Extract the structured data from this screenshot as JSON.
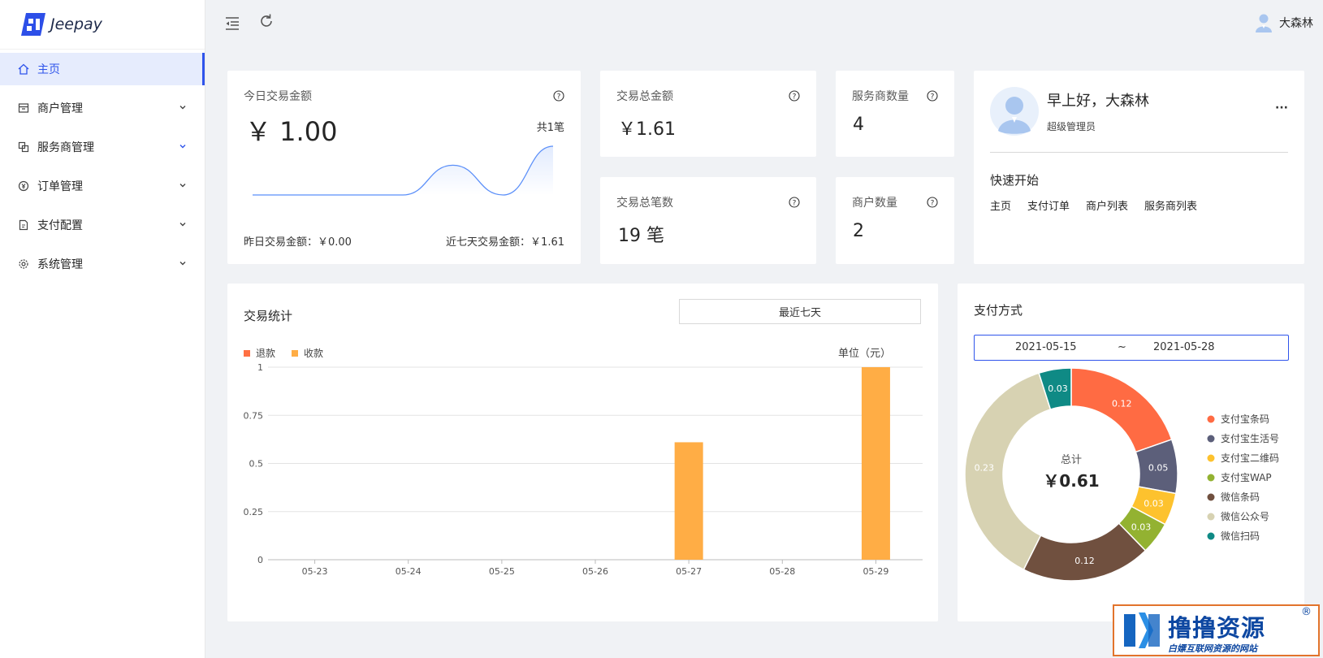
{
  "app": {
    "name": "Jeepay"
  },
  "sidebar": {
    "items": [
      {
        "label": "主页",
        "active": true,
        "icon": "home-icon"
      },
      {
        "label": "商户管理",
        "icon": "shop-icon"
      },
      {
        "label": "服务商管理",
        "icon": "copy-icon"
      },
      {
        "label": "订单管理",
        "icon": "money-icon"
      },
      {
        "label": "支付配置",
        "icon": "file-icon"
      },
      {
        "label": "系统管理",
        "icon": "gear-icon"
      }
    ]
  },
  "user": {
    "name": "大森林"
  },
  "today": {
    "title": "今日交易金额",
    "amount": "￥ 1.00",
    "count": "共1笔",
    "yesterday": "昨日交易金额：￥0.00",
    "week": "近七天交易金额：￥1.61"
  },
  "total_amount": {
    "title": "交易总金额",
    "value": "￥1.61"
  },
  "total_count": {
    "title": "交易总笔数",
    "value": "19 笔"
  },
  "isv_count": {
    "title": "服务商数量",
    "value": "4"
  },
  "mch_count": {
    "title": "商户数量",
    "value": "2"
  },
  "welcome": {
    "greeting": "早上好，大森林",
    "role": "超级管理员",
    "more": "···",
    "quick_title": "快速开始",
    "links": [
      "主页",
      "支付订单",
      "商户列表",
      "服务商列表"
    ]
  },
  "trade": {
    "title": "交易统计",
    "range": "最近七天",
    "unit": "单位（元）",
    "legend": {
      "refund": "退款",
      "income": "收款"
    }
  },
  "pay": {
    "title": "支付方式",
    "date_from": "2021-05-15",
    "date_sep": "~",
    "date_to": "2021-05-28",
    "total_label": "总计",
    "total_value": "￥0.61"
  },
  "chart_data": [
    {
      "type": "line",
      "x": [
        1,
        2,
        3,
        4,
        5,
        6,
        7
      ],
      "values": [
        0,
        0,
        0,
        0,
        0.61,
        0,
        1.0
      ]
    },
    {
      "type": "bar",
      "categories": [
        "05-23",
        "05-24",
        "05-25",
        "05-26",
        "05-27",
        "05-28",
        "05-29"
      ],
      "series": [
        {
          "name": "退款",
          "color": "#ff7043",
          "values": [
            0,
            0,
            0,
            0,
            0,
            0,
            0
          ]
        },
        {
          "name": "收款",
          "color": "#ffad45",
          "values": [
            0,
            0,
            0,
            0,
            0.61,
            0,
            1.0
          ]
        }
      ],
      "yticks": [
        "0",
        "0.25",
        "0.5",
        "0.75",
        "1"
      ],
      "ylim": [
        0,
        1
      ],
      "grid": true,
      "legend": "top-left"
    },
    {
      "type": "pie",
      "donut": true,
      "labels": [
        "支付宝条码",
        "支付宝生活号",
        "支付宝二维码",
        "支付宝WAP",
        "微信条码",
        "微信公众号",
        "微信扫码"
      ],
      "values": [
        0.12,
        0.05,
        0.03,
        0.03,
        0.12,
        0.23,
        0.03
      ],
      "colors": [
        "#ff6b43",
        "#5c5f7a",
        "#fdc22e",
        "#93b231",
        "#70503f",
        "#d7d2b2",
        "#0f8a85"
      ],
      "legend": "right"
    }
  ],
  "watermark": {
    "brand": "撸撸资源",
    "sub": "白嫖互联网资源的网站"
  }
}
